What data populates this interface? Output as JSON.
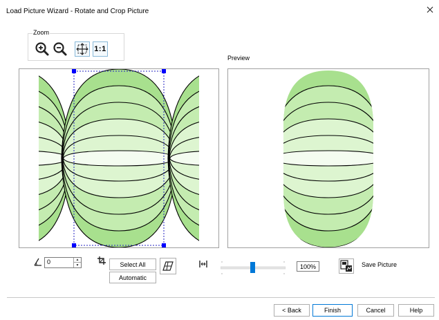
{
  "window": {
    "title": "Load Picture Wizard - Rotate and Crop Picture",
    "close_icon": "close-icon"
  },
  "zoom": {
    "label": "Zoom",
    "buttons": [
      {
        "name": "zoom-in",
        "icon": "zoom-in-icon"
      },
      {
        "name": "zoom-out",
        "icon": "zoom-out-icon"
      },
      {
        "name": "zoom-to-fit",
        "icon": "zoom-fit-icon"
      },
      {
        "name": "actual-size",
        "label": "1:1"
      }
    ]
  },
  "preview": {
    "label": "Preview"
  },
  "rotate": {
    "angle_value": "0",
    "icon": "angle-icon"
  },
  "crop": {
    "icon": "crop-icon",
    "select_all_label": "Select All",
    "automatic_label": "Automatic",
    "auto_crop_icon": "crop-grid-icon"
  },
  "scale": {
    "icon": "scale-horizontal-icon",
    "percent": "100%",
    "slider_value_percent": 100
  },
  "save": {
    "icon": "save-picture-icon",
    "label": "Save Picture"
  },
  "footer": {
    "back_label": "< Back",
    "finish_label": "Finish",
    "cancel_label": "Cancel",
    "help_label": "Help"
  },
  "colors": {
    "fill_outer": "#a8e08e",
    "fill_mid": "#c4ecb0",
    "fill_inner": "#ddf5d0",
    "fill_center": "#f4fcf0",
    "handle": "#0000ff",
    "stroke": "#000000"
  }
}
